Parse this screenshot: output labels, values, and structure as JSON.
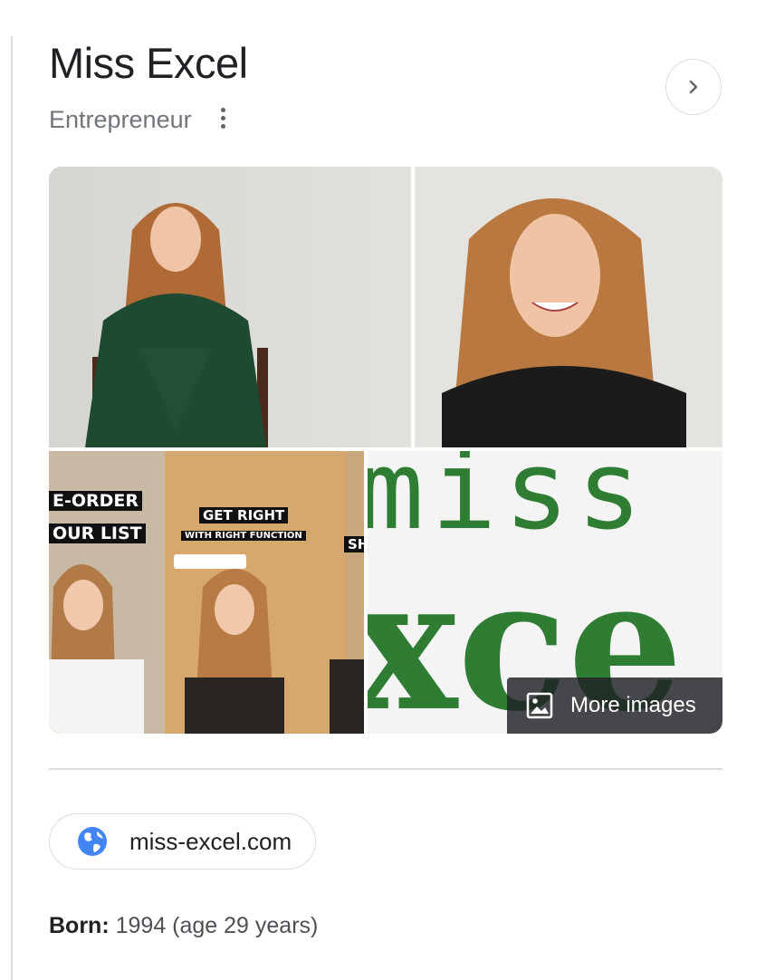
{
  "entity": {
    "title": "Miss Excel",
    "subtitle": "Entrepreneur"
  },
  "images": {
    "more_images_label": "More images",
    "tiles": [
      {
        "name": "photo-green-jumpsuit"
      },
      {
        "name": "photo-portrait-black-top"
      },
      {
        "name": "photo-tiktok-collage",
        "overlays": [
          "E-ORDER",
          "OUR LIST",
          "GET RIGHT",
          "WITH RIGHT FUNCTION",
          "SH"
        ]
      },
      {
        "name": "logo-miss-excel",
        "overlays": [
          "miss",
          "xce"
        ]
      }
    ]
  },
  "website": {
    "label": "miss-excel.com"
  },
  "facts": {
    "born_label": "Born:",
    "born_value": "1994 (age 29 years)"
  },
  "colors": {
    "logo_green": "#2e7d32",
    "globe_blue": "#4285f4",
    "text_primary": "#202124",
    "text_secondary": "#70757a"
  }
}
